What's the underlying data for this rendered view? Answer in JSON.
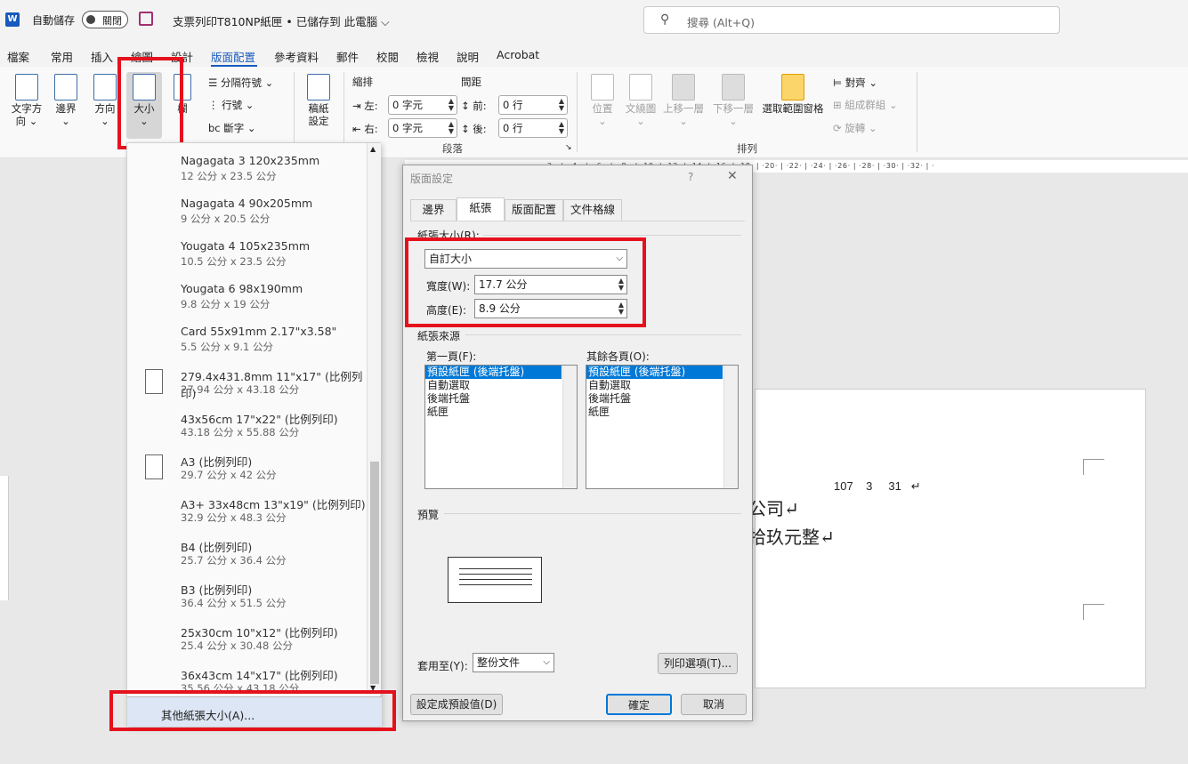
{
  "titlebar": {
    "app_icon": "W",
    "autosave_label": "自動儲存",
    "autosave_state": "關閉",
    "doc_title": "支票列印T810NP紙匣 • 已儲存到 此電腦 ⌵",
    "search_placeholder": "搜尋 (Alt+Q)"
  },
  "menu": {
    "tabs": [
      "檔案",
      "常用",
      "插入",
      "繪圖",
      "設計",
      "版面配置",
      "參考資料",
      "郵件",
      "校閱",
      "檢視",
      "說明",
      "Acrobat"
    ],
    "active": "版面配置"
  },
  "ribbon": {
    "text_direction": "文字方\n向 ⌄",
    "margins": "邊界\n⌄",
    "orientation": "方向\n⌄",
    "size": "大小\n⌄",
    "columns": "欄",
    "breaks": "分隔符號 ⌄",
    "line_numbers": "行號 ⌄",
    "hyphenation": "斷字 ⌄",
    "draft_settings": "稿紙\n設定",
    "indent_label": "縮排",
    "spacing_label": "間距",
    "indent_left_label": "左:",
    "indent_left_value": "0 字元",
    "indent_right_label": "右:",
    "indent_right_value": "0 字元",
    "space_before_label": "前:",
    "space_before_value": "0 行",
    "space_after_label": "後:",
    "space_after_value": "0 行",
    "paragraph_group": "段落",
    "position": "位置\n⌄",
    "wrap_text": "文繞圖\n⌄",
    "bring_forward": "上移一層\n⌄",
    "send_backward": "下移一層\n⌄",
    "selection_pane": "選取範圍窗格",
    "align": "對齊 ⌄",
    "group": "組成群組 ⌄",
    "rotate": "旋轉 ⌄",
    "arrange_group": "排列"
  },
  "ruler": "2 · | · 4 · | · 6 · | · 8 · | ·10· | ·12· | ·14· | ·16· | ·18· | ·20· | ·22· | ·24· | ·26· | ·28· | ·30· | ·32· | ·",
  "page_text": {
    "date": "107    3     31   ↵",
    "line1": "公司↵",
    "line2": "拾玖元整↵"
  },
  "size_dropdown": {
    "items": [
      {
        "name": "Nagagata 3 120x235mm",
        "size": "12 公分 x 23.5 公分",
        "icon": false
      },
      {
        "name": "Nagagata 4 90x205mm",
        "size": "9 公分 x 20.5 公分",
        "icon": false
      },
      {
        "name": "Yougata 4 105x235mm",
        "size": "10.5 公分 x 23.5 公分",
        "icon": false
      },
      {
        "name": "Yougata 6 98x190mm",
        "size": "9.8 公分 x 19 公分",
        "icon": false
      },
      {
        "name": "Card 55x91mm 2.17\"x3.58\"",
        "size": "5.5 公分 x 9.1 公分",
        "icon": false
      },
      {
        "name": "279.4x431.8mm 11\"x17\" (比例列印)",
        "size": "27.94 公分 x 43.18 公分",
        "icon": true
      },
      {
        "name": "43x56cm 17\"x22\" (比例列印)",
        "size": "43.18 公分 x 55.88 公分",
        "icon": false
      },
      {
        "name": "A3 (比例列印)",
        "size": "29.7 公分 x 42 公分",
        "icon": true
      },
      {
        "name": "A3+ 33x48cm 13\"x19\" (比例列印)",
        "size": "32.9 公分 x 48.3 公分",
        "icon": false
      },
      {
        "name": "B4 (比例列印)",
        "size": "25.7 公分 x 36.4 公分",
        "icon": false
      },
      {
        "name": "B3 (比例列印)",
        "size": "36.4 公分 x 51.5 公分",
        "icon": false
      },
      {
        "name": "25x30cm 10\"x12\" (比例列印)",
        "size": "25.4 公分 x 30.48 公分",
        "icon": false
      },
      {
        "name": "36x43cm 14\"x17\" (比例列印)",
        "size": "35.56 公分 x 43.18 公分",
        "icon": false
      }
    ],
    "more_sizes": "其他紙張大小(A)..."
  },
  "dialog": {
    "title": "版面設定",
    "help": "?",
    "close": "✕",
    "tabs": [
      "邊界",
      "紙張",
      "版面配置",
      "文件格線"
    ],
    "active_tab": "紙張",
    "paper_size_label": "紙張大小(R):",
    "paper_size_value": "自訂大小",
    "width_label": "寬度(W):",
    "width_value": "17.7 公分",
    "height_label": "高度(E):",
    "height_value": "8.9 公分",
    "paper_source_label": "紙張來源",
    "first_page_label": "第一頁(F):",
    "other_pages_label": "其餘各頁(O):",
    "sources": [
      "預設紙匣 (後端托盤)",
      "自動選取",
      "後端托盤",
      "紙匣"
    ],
    "preview_label": "預覽",
    "apply_to_label": "套用至(Y):",
    "apply_to_value": "整份文件",
    "print_options": "列印選項(T)...",
    "set_default": "設定成預設值(D)",
    "ok": "確定",
    "cancel": "取消"
  },
  "colors": {
    "accent": "#185abd",
    "highlight_box": "#e5121d",
    "selection": "#0078d7"
  }
}
